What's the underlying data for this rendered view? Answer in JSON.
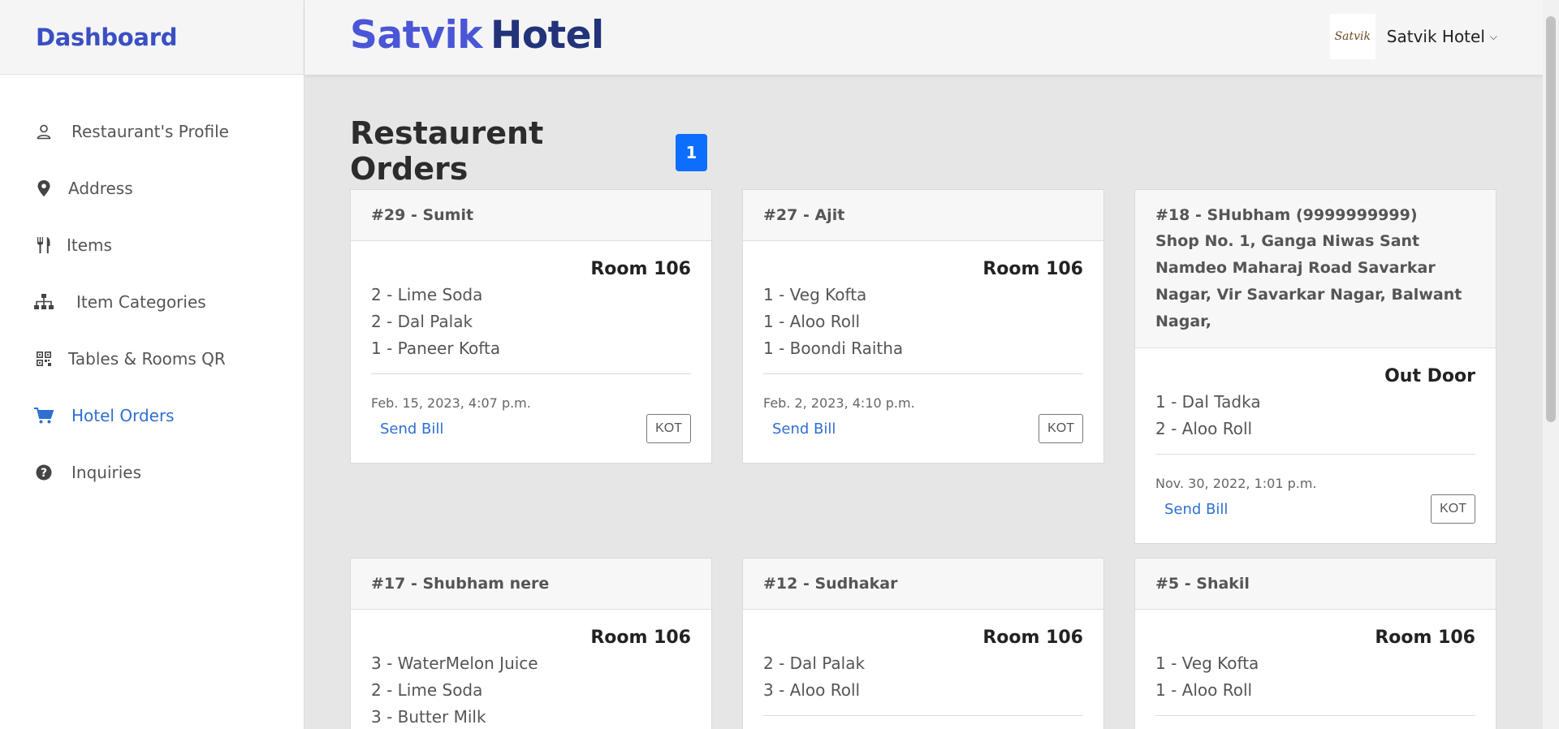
{
  "sidebar": {
    "brand": "Dashboard",
    "items": [
      {
        "label": "Restaurant's Profile",
        "icon": "user-icon"
      },
      {
        "label": "Address",
        "icon": "map-pin-icon"
      },
      {
        "label": "Items",
        "icon": "fork-knife-icon"
      },
      {
        "label": "Item Categories",
        "icon": "sitemap-icon"
      },
      {
        "label": "Tables & Rooms QR",
        "icon": "qr-code-icon"
      },
      {
        "label": "Hotel Orders",
        "icon": "cart-icon",
        "active": true
      },
      {
        "label": "Inquiries",
        "icon": "question-circle-icon"
      }
    ]
  },
  "header": {
    "title_part1": "Satvik",
    "title_part2": "Hotel",
    "avatar_text": "Satvik",
    "user_name": "Satvik Hotel"
  },
  "main": {
    "heading": "Restaurent Orders",
    "badge": "1",
    "orders": [
      {
        "title": "#29 - Sumit",
        "address": "",
        "location": "Room 106",
        "items": [
          "2 - Lime Soda",
          "2 - Dal Palak",
          "1 - Paneer Kofta"
        ],
        "date": "Feb. 15, 2023, 4:07 p.m.",
        "send_bill": "Send Bill",
        "kot": "KOT"
      },
      {
        "title": "#27 - Ajit",
        "address": "",
        "location": "Room 106",
        "items": [
          "1 - Veg Kofta",
          "1 - Aloo Roll",
          "1 - Boondi Raitha"
        ],
        "date": "Feb. 2, 2023, 4:10 p.m.",
        "send_bill": "Send Bill",
        "kot": "KOT"
      },
      {
        "title": "#18 - SHubham (9999999999)",
        "address": "Shop No. 1, Ganga Niwas Sant Namdeo Maharaj Road Savarkar Nagar, Vir Savarkar Nagar, Balwant Nagar,",
        "location": "Out Door",
        "items": [
          "1 - Dal Tadka",
          "2 - Aloo Roll"
        ],
        "date": "Nov. 30, 2022, 1:01 p.m.",
        "send_bill": "Send Bill",
        "kot": "KOT"
      },
      {
        "title": "#17 - Shubham nere",
        "address": "",
        "location": "Room 106",
        "items": [
          "3 - WaterMelon Juice",
          "2 - Lime Soda",
          "3 - Butter Milk"
        ],
        "date": "",
        "send_bill": "",
        "kot": ""
      },
      {
        "title": "#12 - Sudhakar",
        "address": "",
        "location": "Room 106",
        "items": [
          "2 - Dal Palak",
          "3 - Aloo Roll"
        ],
        "date": "",
        "send_bill": "",
        "kot": ""
      },
      {
        "title": "#5 - Shakil",
        "address": "",
        "location": "Room 106",
        "items": [
          "1 - Veg Kofta",
          "1 - Aloo Roll"
        ],
        "date": "",
        "send_bill": "",
        "kot": ""
      }
    ]
  }
}
